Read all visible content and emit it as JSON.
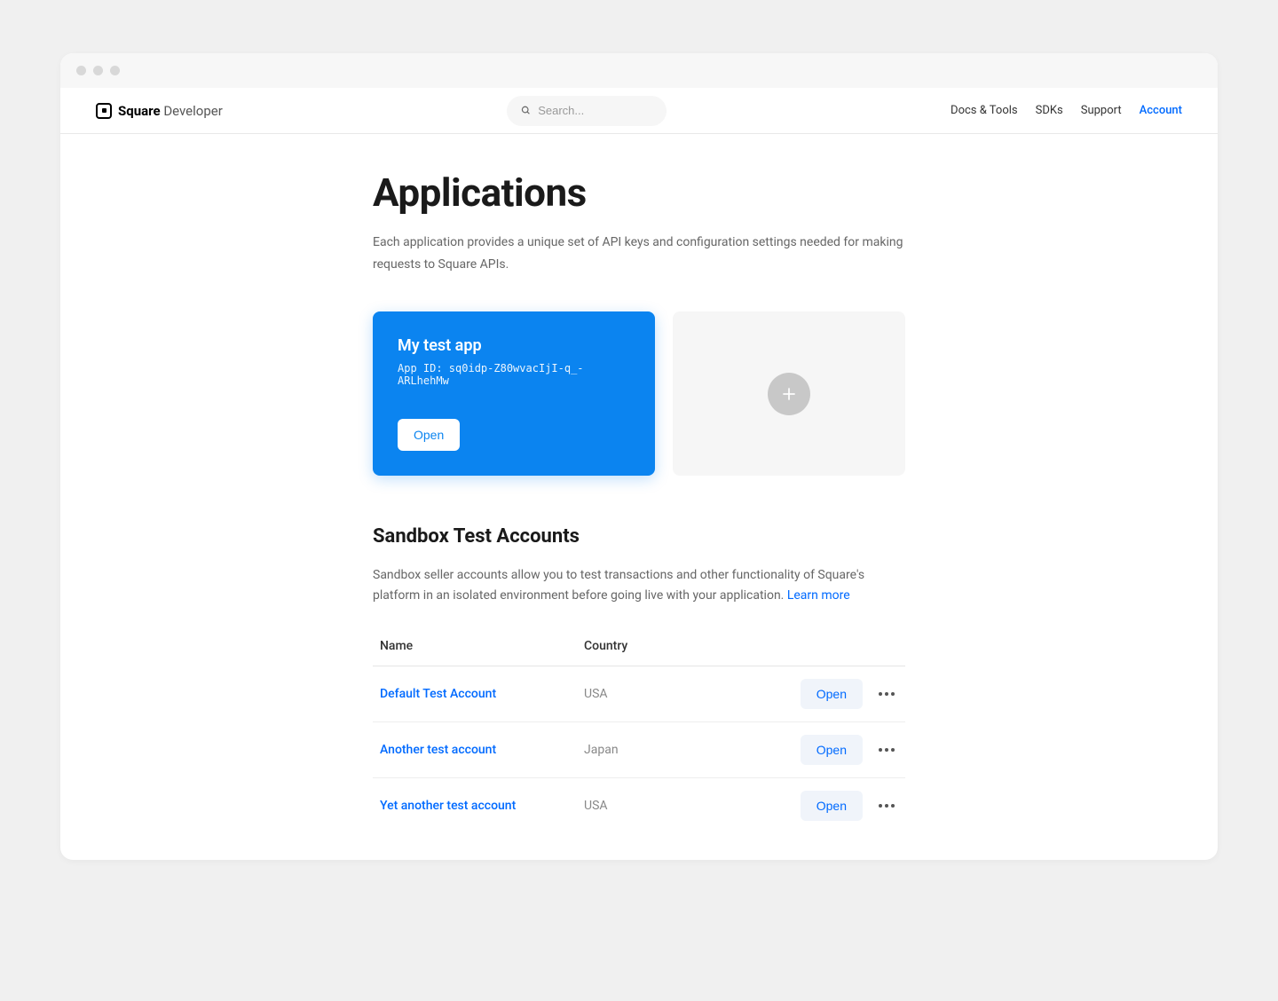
{
  "logo": {
    "brand": "Square",
    "product": "Developer"
  },
  "search": {
    "placeholder": "Search..."
  },
  "nav": {
    "docs": "Docs & Tools",
    "sdks": "SDKs",
    "support": "Support",
    "account": "Account"
  },
  "page": {
    "title": "Applications",
    "subtitle": "Each application provides a unique set of API keys and configuration settings needed for making requests to Square APIs."
  },
  "app_card": {
    "name": "My test app",
    "app_id_label": "App ID: sq0idp-Z80wvacIjI-q_-ARLhehMw",
    "open": "Open"
  },
  "sandbox": {
    "title": "Sandbox Test Accounts",
    "description": "Sandbox seller accounts allow you to test transactions and other functionality of Square's platform in an isolated environment before going live with your application. ",
    "learn_more": "Learn more",
    "columns": {
      "name": "Name",
      "country": "Country"
    },
    "open_label": "Open",
    "accounts": [
      {
        "name": "Default Test Account",
        "country": "USA"
      },
      {
        "name": "Another test account",
        "country": "Japan"
      },
      {
        "name": "Yet another test account",
        "country": "USA"
      }
    ]
  }
}
